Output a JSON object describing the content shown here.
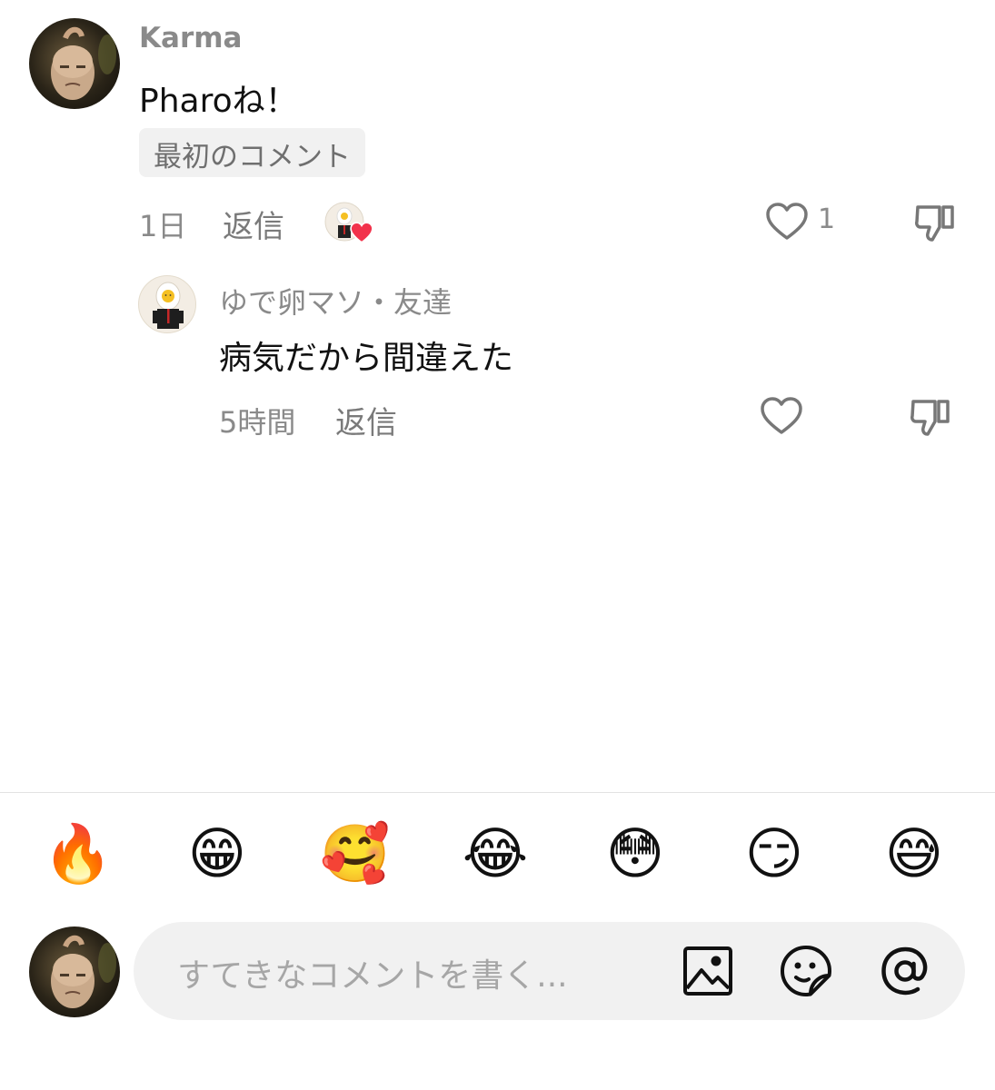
{
  "thread": {
    "comment": {
      "username": "Karma",
      "text": "Pharoね！",
      "tag": "最初のコメント",
      "time": "1日",
      "reply_label": "返信",
      "like_count": "1"
    },
    "reply": {
      "username": "ゆで卵マソ・友達",
      "text": "病気だから間違えた",
      "time": "5時間",
      "reply_label": "返信"
    }
  },
  "quick_reactions": [
    "🔥",
    "😁",
    "🥰",
    "😂",
    "😳",
    "😏",
    "😅"
  ],
  "composer": {
    "placeholder": "すてきなコメントを書く..."
  },
  "icons": {
    "like": "heart-outline-icon",
    "dislike": "thumbs-down-icon",
    "image": "image-icon",
    "sticker": "sticker-icon",
    "mention": "at-icon"
  },
  "colors": {
    "liked_heart": "#f2324b",
    "muted_text": "#8a8a8a",
    "composer_bg": "#f1f1f1"
  }
}
